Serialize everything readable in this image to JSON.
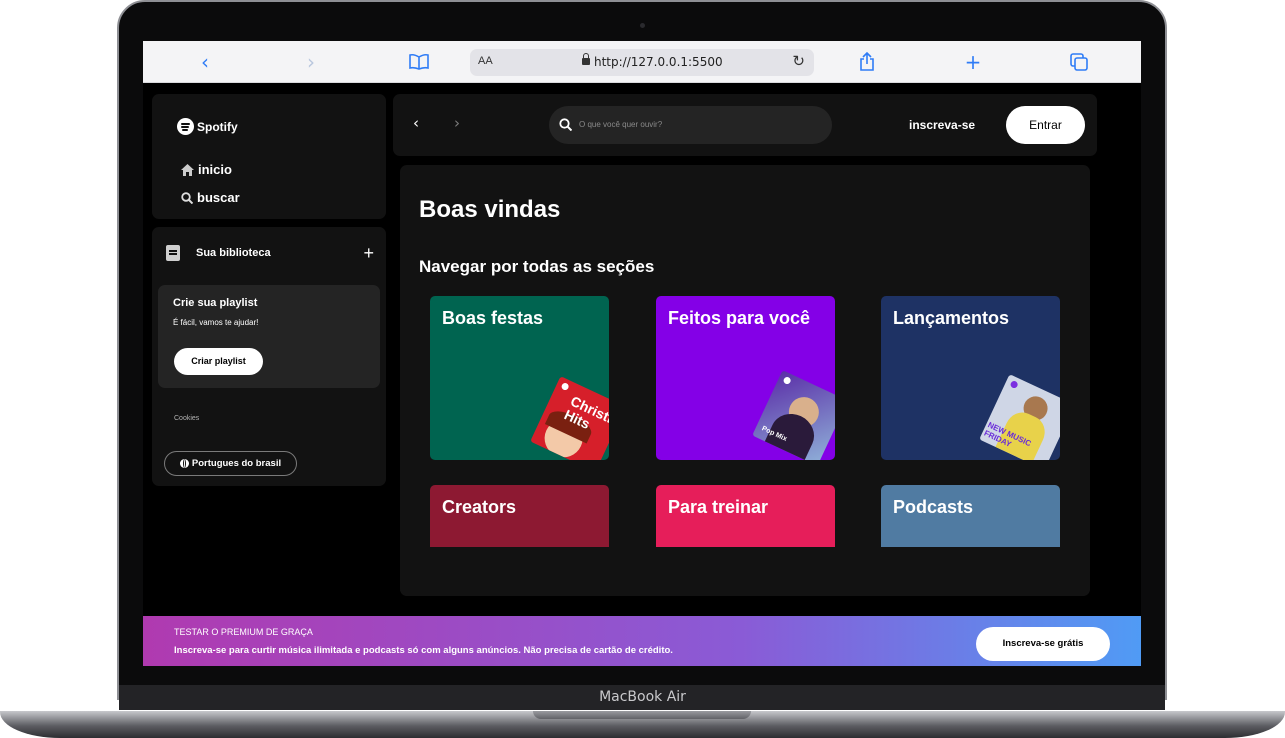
{
  "device": {
    "model_label": "MacBook Air"
  },
  "browser": {
    "text_size_label": "AA",
    "url": "http://127.0.0.1:5500",
    "icons": [
      "back-icon",
      "forward-icon",
      "reader-book-icon",
      "lock-icon",
      "reload-icon",
      "share-icon",
      "new-tab-plus-icon",
      "tabs-icon"
    ]
  },
  "sidebar": {
    "brand": "Spotify",
    "nav": [
      {
        "label": "inicio",
        "icon": "home-icon"
      },
      {
        "label": "buscar",
        "icon": "search-icon"
      }
    ],
    "library": {
      "title": "Sua biblioteca",
      "add_icon": "plus-icon",
      "playlist_card": {
        "title": "Crie sua playlist",
        "subtitle": "É fácil, vamos te ajudar!",
        "button": "Criar playlist"
      },
      "cookies": "Cookies",
      "language_button": "Portugues do brasil"
    }
  },
  "topbar": {
    "search_placeholder": "O que você quer ouvir?",
    "signup_link": "inscreva-se",
    "login_button": "Entrar"
  },
  "main": {
    "welcome": "Boas vindas",
    "section_title": "Navegar por todas as seções",
    "cards": [
      {
        "title": "Boas festas",
        "color": "#006450",
        "cover_text": "Christmas Hits",
        "cover_color": "#e02b2b"
      },
      {
        "title": "Feitos para você",
        "color": "#8400e7",
        "cover_text": "Pop Mix",
        "cover_color": "#7a4fd0"
      },
      {
        "title": "Lançamentos",
        "color": "#1e3264",
        "cover_text": "NEW MUSIC FRIDAY",
        "cover_color": "#cfd6e6"
      },
      {
        "title": "Creators",
        "color": "#8d1932"
      },
      {
        "title": "Para treinar",
        "color": "#e61e5a"
      },
      {
        "title": "Podcasts",
        "color": "#507ba2"
      }
    ]
  },
  "premium_banner": {
    "title": "TESTAR O PREMIUM DE GRAÇA",
    "text": "Inscreva-se para curtir música ilimitada e podcasts só com alguns anúncios. Não precisa de cartão de crédito.",
    "button": "Inscreva-se grátis"
  }
}
